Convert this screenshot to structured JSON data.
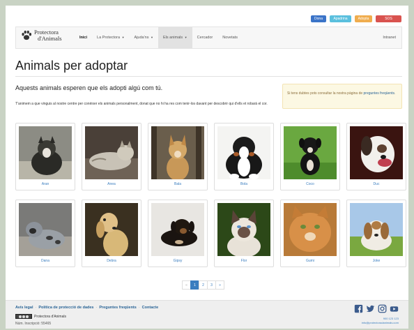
{
  "top_buttons": [
    {
      "label": "Dona",
      "color": "#3b74c8"
    },
    {
      "label": "Apadrina",
      "color": "#5bc0de"
    },
    {
      "label": "Adopta",
      "color": "#f0ad4e"
    },
    {
      "label": "SOS Perduts",
      "color": "#d9534f"
    }
  ],
  "logo": {
    "line1": "Protectora",
    "line2": "d'Animals",
    "icon": "paw-icon"
  },
  "nav": {
    "items": [
      "Inici",
      "La Protectora",
      "Ajuda'ns",
      "Els animals",
      "Cercador",
      "Novetats"
    ],
    "intranet": "Intranet"
  },
  "page": {
    "title": "Animals per adoptar",
    "subtitle": "Aquests animals esperen que els adopti algú com tú.",
    "intro": "T'animem a que vinguis al nostre centre per conèixer els animals personalment, donat que no hi ha res com tenir-los davant per descobrir qui d'ells et robarà el cor.",
    "alert_text": "Si tens dubtes pots consultar la nostra pàgina de",
    "alert_link": "preguntes freqüents",
    "alert_end": "."
  },
  "animals": [
    {
      "name": "Aran",
      "kind": "dog"
    },
    {
      "name": "Anea",
      "kind": "cat"
    },
    {
      "name": "Bala",
      "kind": "dog"
    },
    {
      "name": "Bola",
      "kind": "dog"
    },
    {
      "name": "Coco",
      "kind": "dog"
    },
    {
      "name": "Duc",
      "kind": "dog"
    },
    {
      "name": "Dana",
      "kind": "dog"
    },
    {
      "name": "Debra",
      "kind": "dog"
    },
    {
      "name": "Gipsy",
      "kind": "dog"
    },
    {
      "name": "Flor",
      "kind": "cat"
    },
    {
      "name": "Gumi",
      "kind": "cat"
    },
    {
      "name": "Joke",
      "kind": "dog"
    }
  ],
  "pagination": {
    "prev": "«",
    "pages": [
      "1",
      "2",
      "3"
    ],
    "next": "»",
    "active": "1"
  },
  "footer": {
    "links": [
      "Avís legal",
      "Política de protecció de dades",
      "Preguntes freqüents",
      "Contacte"
    ],
    "org": "Protectora d'Animals",
    "registration": "Núm. Inscripció: 55465",
    "phone": "900 123 123",
    "email": "info@protectoradanimals.com",
    "social": [
      "facebook-icon",
      "twitter-icon",
      "instagram-icon",
      "youtube-icon"
    ]
  }
}
